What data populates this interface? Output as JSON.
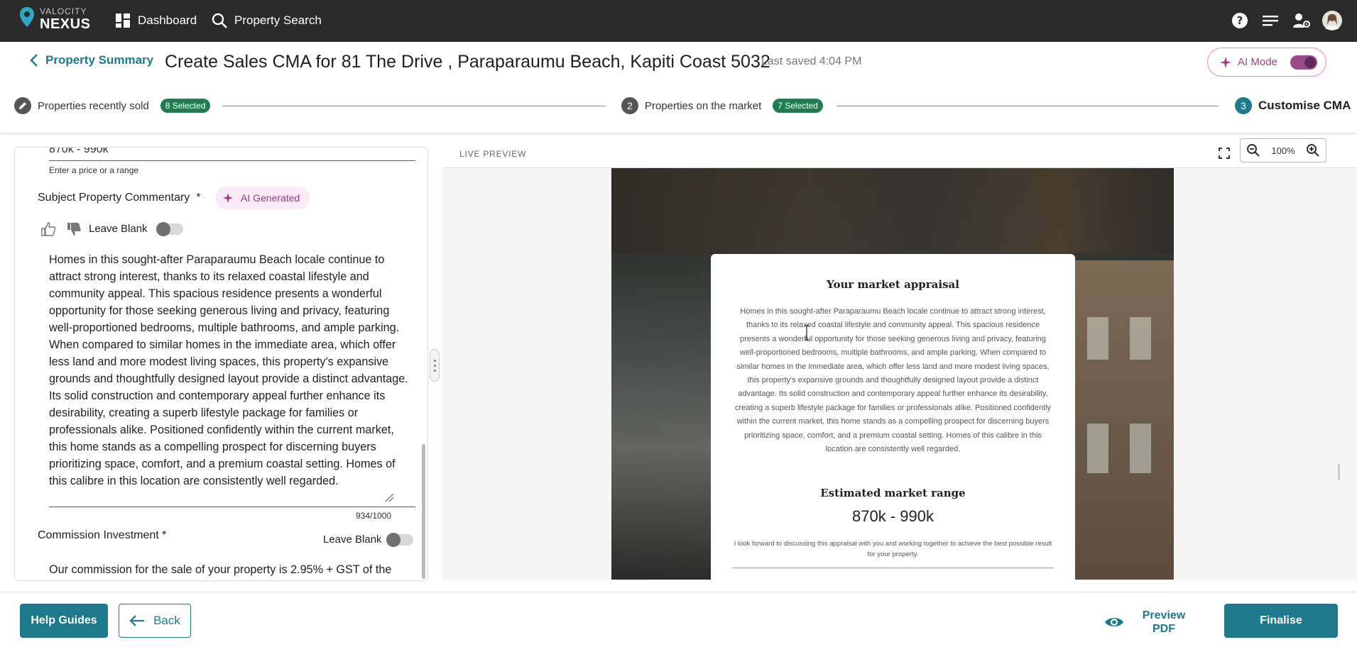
{
  "nav": {
    "logo_line1": "VALOCITY",
    "logo_line2": "NEXUS",
    "dashboard_label": "Dashboard",
    "property_search_label": "Property Search",
    "icons": [
      "help-icon",
      "menu-icon",
      "user-settings-icon",
      "avatar"
    ]
  },
  "header": {
    "back_label": "Property Summary",
    "title": "Create Sales CMA for 81 The Drive , Paraparaumu Beach, Kapiti Coast 5032",
    "last_saved": "Last saved 4:04 PM",
    "ai_mode_label": "AI Mode",
    "ai_mode_on": true
  },
  "steps": [
    {
      "number": "",
      "label": "Properties recently sold",
      "badge": "8 Selected"
    },
    {
      "number": "2",
      "label": "Properties on the market",
      "badge": "7 Selected"
    },
    {
      "number": "3",
      "label": "Customise CMA",
      "badge": ""
    }
  ],
  "form": {
    "price_value": "870k - 990k",
    "price_helper": "Enter a price or a range",
    "commentary_label": "Subject Property Commentary",
    "required_mark": "*",
    "ai_chip_label": "AI Generated",
    "leave_blank_label": "Leave Blank",
    "commentary_text": "Homes in this sought-after Paraparaumu Beach locale continue to attract strong interest, thanks to its relaxed coastal lifestyle and community appeal. This spacious residence presents a wonderful opportunity for those seeking generous living and privacy, featuring well-proportioned bedrooms, multiple bathrooms, and ample parking. When compared to similar homes in the immediate area, which offer less land and more modest living spaces, this property's expansive grounds and thoughtfully designed layout provide a distinct advantage. Its solid construction and contemporary appeal further enhance its desirability, creating a superb lifestyle package for families or professionals alike. Positioned confidently within the current market, this home stands as a compelling prospect for discerning buyers prioritizing space, comfort, and a premium coastal setting. Homes of this calibre in this location are consistently well regarded.",
    "char_count": "934/1000",
    "commission_label": "Commission Investment *",
    "commission_text": "Our commission for the sale of your property is 2.95% + GST of the"
  },
  "preview": {
    "label": "LIVE PREVIEW",
    "zoom": "100%",
    "card_title": "Your market appraisal",
    "card_body": "Homes in this sought-after Paraparaumu Beach locale continue to attract strong interest, thanks to its relaxed coastal lifestyle and community appeal. This spacious residence presents a wonderful opportunity for those seeking generous living and privacy, featuring well-proportioned bedrooms, multiple bathrooms, and ample parking. When compared to similar homes in the immediate area, which offer less land and more modest living spaces, this property's expansive grounds and thoughtfully designed layout provide a distinct advantage. Its solid construction and contemporary appeal further enhance its desirability, creating a superb lifestyle package for families or professionals alike. Positioned confidently within the current market, this home stands as a compelling prospect for discerning buyers prioritizing space, comfort, and a premium coastal setting. Homes of this calibre in this location are consistently well regarded.",
    "range_title": "Estimated market range",
    "range_value": "870k - 990k",
    "footer_text": "I look forward to discussing this appraisal with you and working together to achieve the best possible result for your property."
  },
  "footer": {
    "help_label": "Help Guides",
    "back_label": "Back",
    "preview_label": "Preview PDF",
    "finalise_label": "Finalise"
  },
  "colors": {
    "accent": "#1d7a8c",
    "badge": "#1f7d52",
    "ai": "#a1418a"
  }
}
